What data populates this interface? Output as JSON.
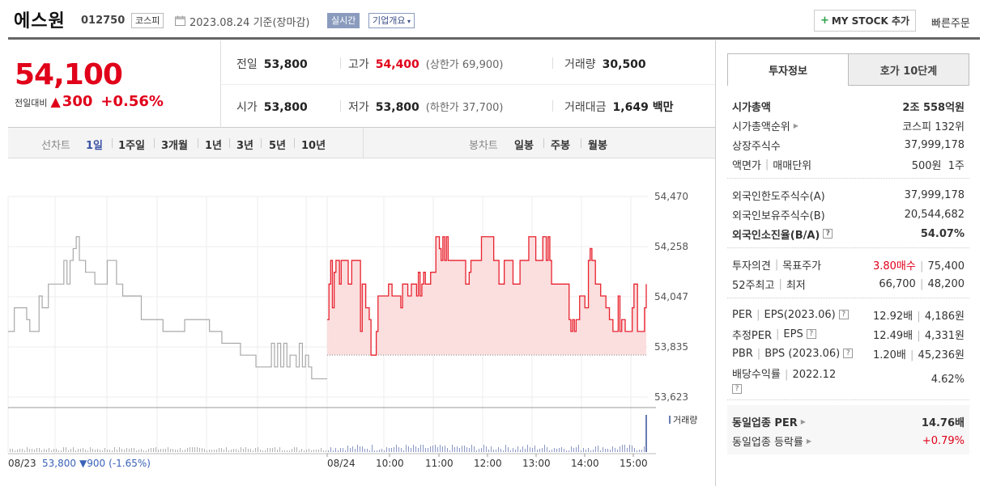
{
  "header": {
    "stock_name": "에스원",
    "stock_code": "012750",
    "market": "코스피",
    "date_text": "2023.08.24 기준(장마감)",
    "realtime_label": "실시간",
    "company_label": "기업개요",
    "mystock_label": "MY STOCK 추가",
    "quick_order_label": "빠른주문"
  },
  "price": {
    "current": "54,100",
    "change_label": "전일대비",
    "change_amount": "300",
    "change_rate": "+0.56%",
    "prev_close_label": "전일",
    "prev_close": "53,800",
    "open_label": "시가",
    "open": "53,800",
    "high_label": "고가",
    "high": "54,400",
    "upper_limit_label": "(상한가",
    "upper_limit": "69,900)",
    "low_label": "저가",
    "low": "53,800",
    "lower_limit_label": "(하한가",
    "lower_limit": "37,700)",
    "volume_label": "거래량",
    "volume": "30,500",
    "amount_label": "거래대금",
    "amount": "1,649",
    "amount_unit": "백만"
  },
  "toolbar": {
    "line_chart_label": "선차트",
    "periods": [
      "1일",
      "1주일",
      "3개월",
      "1년",
      "3년",
      "5년",
      "10년"
    ],
    "candle_label": "봉차트",
    "candles": [
      "일봉",
      "주봉",
      "월봉"
    ]
  },
  "chart_data": {
    "type": "line",
    "yticks": [
      "54,470",
      "54,258",
      "54,047",
      "53,835",
      "53,623"
    ],
    "ylim": [
      53623,
      54470
    ],
    "xticks": [
      "08/23",
      "08/24",
      "10:00",
      "11:00",
      "12:00",
      "13:00",
      "14:00",
      "15:00"
    ],
    "prev_close_line": 53800,
    "volume_label": "거래량",
    "prev_day_summary": {
      "date": "08/23",
      "close": "53,800",
      "change": "▼900",
      "rate": "(-1.65%)"
    },
    "series": [
      {
        "values": [
          53900,
          53900,
          54000,
          54000,
          54000,
          54000,
          53950,
          53900,
          53900,
          53900,
          54050,
          54000,
          54000,
          54100,
          54100,
          54100,
          54100,
          54100,
          54200,
          54100,
          54200,
          54250,
          54300,
          54200,
          54200,
          54150,
          54150,
          54150,
          54100,
          54100,
          54100,
          54100,
          54200,
          54200,
          54200,
          54100,
          54100,
          54050,
          54050,
          54050,
          54050,
          54050,
          54050,
          53950,
          53950,
          53950,
          53950,
          53950,
          53950,
          53950,
          53900,
          53900,
          53900,
          53900,
          53900,
          53900,
          53900,
          53950,
          53950,
          53950,
          53950,
          53950,
          53950,
          53950,
          53950,
          53900,
          53900,
          53900,
          53900,
          53850,
          53850,
          53850,
          53850,
          53850,
          53850,
          53800,
          53800,
          53800,
          53800,
          53800,
          53750,
          53750,
          53750,
          53750,
          53750,
          53850,
          53750,
          53850,
          53750,
          53850,
          53750,
          53800,
          53800,
          53750,
          53850,
          53750,
          53800,
          53750,
          53700,
          53700,
          53700,
          53700,
          53700,
          53700
        ]
      },
      {
        "values": [
          53950,
          54100,
          54200,
          54000,
          54150,
          54200,
          54200,
          54100,
          54200,
          54200,
          54200,
          54200,
          54100,
          54100,
          54200,
          54200,
          54200,
          54200,
          54200,
          53900,
          54100,
          54100,
          54000,
          54000,
          53950,
          53800,
          53800,
          53800,
          53900,
          54050,
          54050,
          54050,
          54050,
          54050,
          54050,
          54100,
          54100,
          54050,
          54050,
          54050,
          54050,
          54050,
          54000,
          54100,
          54100,
          54100,
          54050,
          54050,
          54100,
          54100,
          54100,
          54050,
          54150,
          54050,
          54100,
          54150,
          54100,
          54100,
          54100,
          54150,
          54150,
          54150,
          54300,
          54300,
          54250,
          54200,
          54300,
          54200,
          54300,
          54200,
          54200,
          54200,
          54200,
          54200,
          54200,
          54200,
          54200,
          54200,
          54200,
          54100,
          54100,
          54150,
          54200,
          54200,
          54200,
          54200,
          54200,
          54200,
          54300,
          54300,
          54300,
          54300,
          54300,
          54300,
          54300,
          54200,
          54200,
          54200,
          54100,
          54100,
          54100,
          54200,
          54200,
          54200,
          54200,
          54200,
          54100,
          54100,
          54100,
          54100,
          54200,
          54200,
          54200,
          54200,
          54200,
          54300,
          54300,
          54300,
          54300,
          54200,
          54200,
          54200,
          54200,
          54300,
          54300,
          54200,
          54300,
          54200,
          54100,
          54100,
          54100,
          54100,
          54100,
          54100,
          54100,
          54100,
          54100,
          54100,
          53950,
          53900,
          53950,
          53900,
          53950,
          53950,
          54050,
          54050,
          54050,
          54000,
          54000,
          54200,
          54250,
          54200,
          54200,
          54100,
          54100,
          54100,
          54050,
          54050,
          54050,
          54000,
          54000,
          53950,
          53950,
          53900,
          53900,
          53900,
          54050,
          53900,
          53950,
          53950,
          53900,
          53900,
          53900,
          53900,
          54000,
          54100,
          54100,
          53900,
          53900,
          53900,
          53900,
          54000,
          54100
        ]
      }
    ]
  },
  "right_panel": {
    "tab_active": "투자정보",
    "tab_inactive": "호가 10단계",
    "market_cap_label": "시가총액",
    "market_cap": "2조 558억원",
    "market_rank_label": "시가총액순위",
    "market_rank": "코스피 132위",
    "shares_label": "상장주식수",
    "shares": "37,999,178",
    "par_label": "액면가",
    "unit_label": "매매단위",
    "par_unit": "500원  1주",
    "foreign_limit_label": "외국인한도주식수(A)",
    "foreign_limit": "37,999,178",
    "foreign_hold_label": "외국인보유주식수(B)",
    "foreign_hold": "20,544,682",
    "foreign_ratio_label": "외국인소진율(B/A)",
    "foreign_ratio": "54.07%",
    "opinion_label": "투자의견",
    "target_label": "목표주가",
    "opinion": "3.80매수",
    "target": "75,400",
    "week52_high_label": "52주최고",
    "week52_low_label": "최저",
    "week52_high": "66,700",
    "week52_low": "48,200",
    "per_label": "PER",
    "eps_label": "EPS(2023.06)",
    "per": "12.92배",
    "eps": "4,186원",
    "est_per_label": "추정PER",
    "est_eps_label": "EPS",
    "est_per": "12.49배",
    "est_eps": "4,331원",
    "pbr_label": "PBR",
    "bps_label": "BPS (2023.06)",
    "pbr": "1.20배",
    "bps": "45,236원",
    "dividend_label": "배당수익률",
    "dividend_year": "2022.12",
    "dividend": "4.62%",
    "sector_per_label": "동일업종 PER",
    "sector_per": "14.76배",
    "sector_change_label": "동일업종 등락률",
    "sector_change": "+0.79%"
  }
}
